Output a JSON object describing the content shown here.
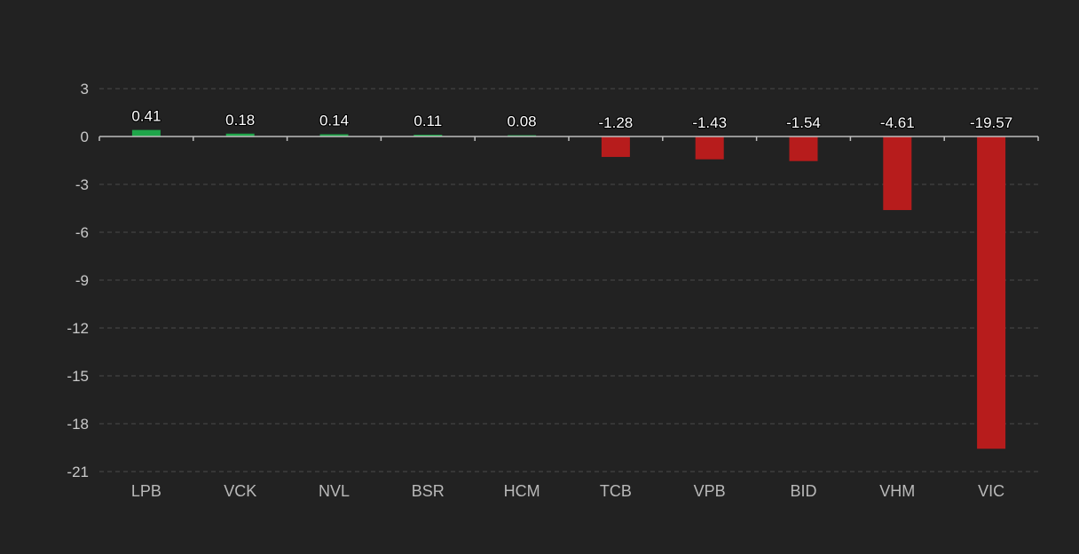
{
  "colors": {
    "background": "#222222",
    "positive": "#1fa64a",
    "negative": "#b71c1c"
  },
  "chart_data": {
    "type": "bar",
    "title": "",
    "xlabel": "",
    "ylabel": "",
    "categories": [
      "LPB",
      "VCK",
      "NVL",
      "BSR",
      "HCM",
      "TCB",
      "VPB",
      "BID",
      "VHM",
      "VIC"
    ],
    "values": [
      0.41,
      0.18,
      0.14,
      0.11,
      0.08,
      -1.28,
      -1.43,
      -1.54,
      -4.61,
      -19.57
    ],
    "data_labels": [
      "0.41",
      "0.18",
      "0.14",
      "0.11",
      "0.08",
      "-1.28",
      "-1.43",
      "-1.54",
      "-4.61",
      "-19.57"
    ],
    "y_ticks": [
      3,
      0,
      -3,
      -6,
      -9,
      -12,
      -15,
      -18,
      -21
    ],
    "y_tick_labels": [
      "3",
      "0",
      "-3",
      "-6",
      "-9",
      "-12",
      "-15",
      "-18",
      "-21"
    ],
    "ylim": [
      -21,
      3
    ],
    "grid": true,
    "legend": "none"
  }
}
